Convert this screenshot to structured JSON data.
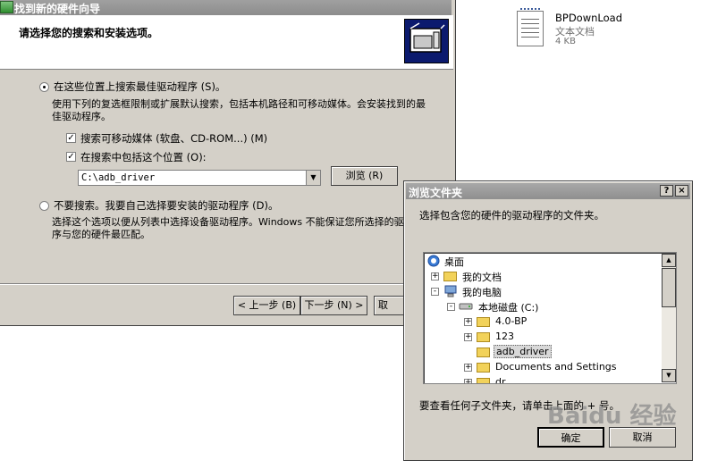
{
  "wizard": {
    "title": "找到新的硬件向导",
    "header_title": "请选择您的搜索和安装选项。",
    "option_search": {
      "label": "在这些位置上搜索最佳驱动程序 (S)。",
      "desc": "使用下列的复选框限制或扩展默认搜索，包括本机路径和可移动媒体。会安装找到的最佳驱动程序。",
      "selected": true
    },
    "check_removable": {
      "label": "搜索可移动媒体 (软盘、CD-ROM...) (M)",
      "checked": true
    },
    "check_include": {
      "label": "在搜索中包括这个位置 (O):",
      "checked": true
    },
    "path_value": "C:\\adb_driver",
    "browse_button": "浏览 (R)",
    "option_dont_search": {
      "label": "不要搜索。我要自己选择要安装的驱动程序 (D)。",
      "desc": "选择这个选项以便从列表中选择设备驱动程序。Windows 不能保证您所选择的驱动程序与您的硬件最匹配。",
      "selected": false
    },
    "back_button": "< 上一步 (B)",
    "next_button": "下一步 (N) >",
    "cancel_partial": "取"
  },
  "desktop_file": {
    "name": "BPDownLoad",
    "type": "文本文档",
    "size": "4 KB"
  },
  "browse_dialog": {
    "title": "浏览文件夹",
    "help_btn": "?",
    "close_btn": "×",
    "instruction": "选择包含您的硬件的驱动程序的文件夹。",
    "tree": [
      {
        "label": "桌面",
        "icon": "desktop-icon",
        "expander": ""
      },
      {
        "label": "我的文档",
        "icon": "folder-icon",
        "expander": "+"
      },
      {
        "label": "我的电脑",
        "icon": "computer-icon",
        "expander": "-"
      },
      {
        "label": "本地磁盘 (C:)",
        "icon": "drive-icon",
        "expander": "-"
      },
      {
        "label": "4.0-BP",
        "icon": "folder-icon",
        "expander": "+"
      },
      {
        "label": "123",
        "icon": "folder-icon",
        "expander": "+"
      },
      {
        "label": "adb_driver",
        "icon": "folder-icon",
        "expander": "",
        "selected": true
      },
      {
        "label": "Documents and Settings",
        "icon": "folder-icon",
        "expander": "+"
      },
      {
        "label": "dr",
        "icon": "folder-icon",
        "expander": "+"
      }
    ],
    "hint": "要查看任何子文件夹，请单击上面的 + 号。",
    "ok_button": "确定",
    "cancel_button": "取消"
  },
  "watermark": "Baidu 经验"
}
